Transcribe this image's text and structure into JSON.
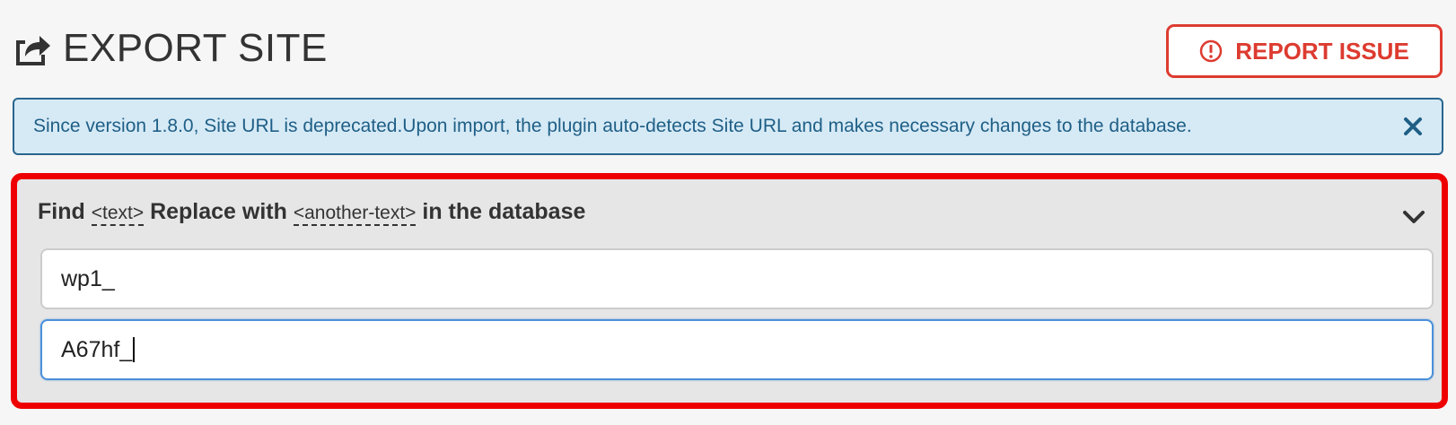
{
  "header": {
    "title": "EXPORT SITE",
    "icon": "share-export-icon"
  },
  "report_button": {
    "label": "REPORT ISSUE",
    "icon": "alert-circle-icon",
    "color": "#dd3b30"
  },
  "notice": {
    "text": "Since version 1.8.0, Site URL is deprecated.Upon import, the plugin auto-detects Site URL and makes necessary changes to the database.",
    "close_icon": "close-icon",
    "background": "#d6eaf6",
    "border": "#28668f"
  },
  "find_replace": {
    "heading_find": "Find",
    "heading_text_token": "<text>",
    "heading_replace": "Replace with",
    "heading_another_token": "<another-text>",
    "heading_suffix": "in the database",
    "collapse_icon": "chevron-down-icon",
    "find_value": "wp1_",
    "replace_value": "A67hf_",
    "highlight_border": "#ee0000"
  }
}
